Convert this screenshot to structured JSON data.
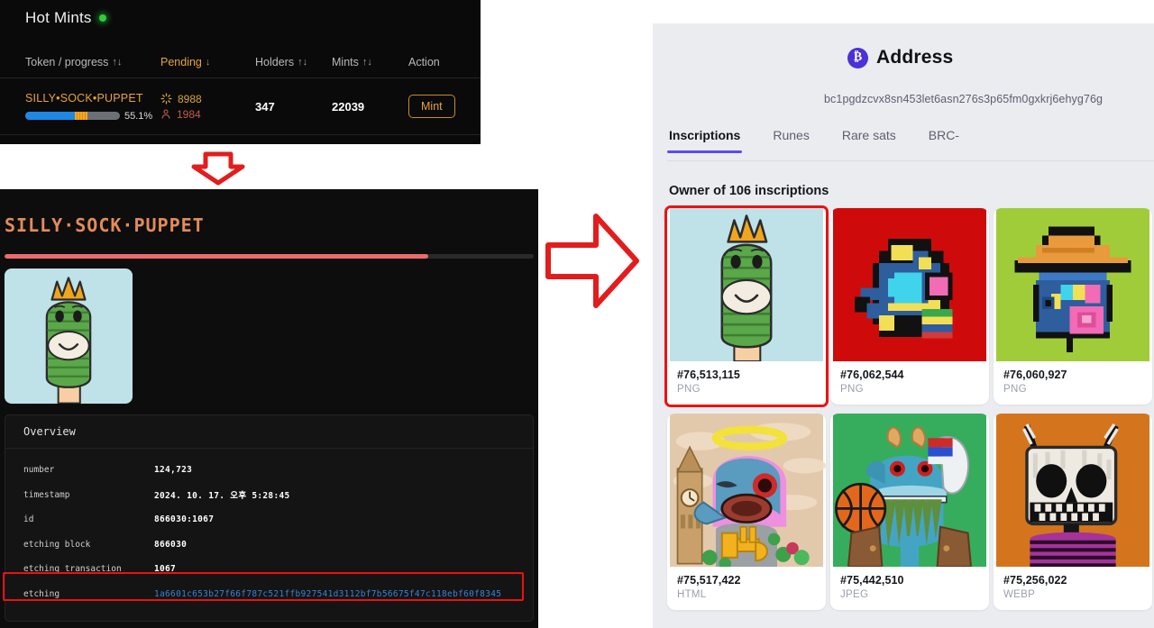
{
  "hot_mints": {
    "title": "Hot Mints",
    "status_dot_color": "#2ecc40",
    "columns": [
      {
        "label": "Token / progress",
        "sort": "↑↓"
      },
      {
        "label": "Pending",
        "sort": "↓"
      },
      {
        "label": "Holders",
        "sort": "↑↓"
      },
      {
        "label": "Mints",
        "sort": "↑↓"
      },
      {
        "label": "Action",
        "sort": ""
      }
    ],
    "rows": [
      {
        "token": "SILLY•SOCK•PUPPET",
        "progress_percent": "55.1%",
        "pending_mints": "8988",
        "pending_holders": "1984",
        "holders": "347",
        "mints": "22039",
        "action_label": "Mint"
      }
    ]
  },
  "token_detail": {
    "title": "SILLY·SOCK·PUPPET",
    "overview_label": "Overview",
    "fields": [
      {
        "key": "number",
        "value": "124,723",
        "link": false
      },
      {
        "key": "timestamp",
        "value": "2024. 10. 17. 오후 5:28:45",
        "link": false
      },
      {
        "key": "id",
        "value": "866030:1067",
        "link": false
      },
      {
        "key": "etching block",
        "value": "866030",
        "link": false
      },
      {
        "key": "etching transaction",
        "value": "1067",
        "link": false
      },
      {
        "key": "etching",
        "value": "1a6601c653b27f66f787c521ffb927541d3112bf7b56675f47c118ebf60f8345",
        "link": true
      }
    ]
  },
  "address_page": {
    "header": {
      "icon": "bitcoin-icon",
      "title": "Address",
      "address": "bc1pgdzcvx8sn453let6asn276s3p65fm0gxkrj6ehyg76g"
    },
    "tabs": [
      {
        "label": "Inscriptions",
        "active": true
      },
      {
        "label": "Runes",
        "active": false
      },
      {
        "label": "Rare sats",
        "active": false
      },
      {
        "label": "BRC-",
        "active": false
      }
    ],
    "owner_line": "Owner of 106 inscriptions",
    "inscriptions": [
      {
        "id": "#76,513,115",
        "type": "PNG",
        "selected": true,
        "art": "sock-puppet"
      },
      {
        "id": "#76,062,544",
        "type": "PNG",
        "selected": false,
        "art": "red-pixel"
      },
      {
        "id": "#76,060,927",
        "type": "PNG",
        "selected": false,
        "art": "green-straw-hat"
      },
      {
        "id": "#75,517,422",
        "type": "HTML",
        "selected": false,
        "art": "halo-dolphin"
      },
      {
        "id": "#75,442,510",
        "type": "JPEG",
        "selected": false,
        "art": "basketball-puppet"
      },
      {
        "id": "#75,256,022",
        "type": "WEBP",
        "selected": false,
        "art": "skull-robot"
      }
    ]
  },
  "annotations": {
    "down_arrow": "down-arrow",
    "right_arrow": "right-arrow",
    "highlight_color": "#ee1111"
  }
}
